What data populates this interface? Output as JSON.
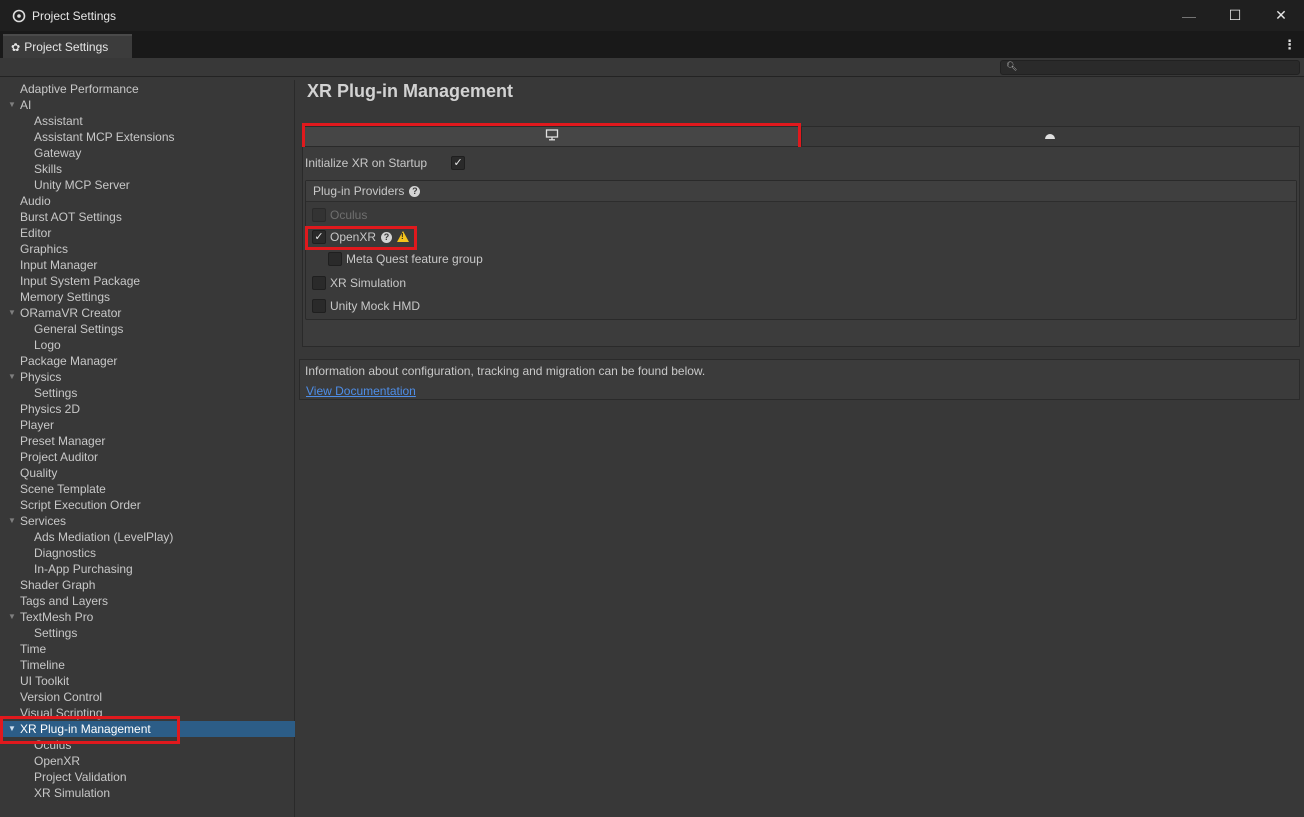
{
  "window": {
    "title": "Project Settings",
    "controls": {
      "minimize": "—",
      "maximize": "☐",
      "close": "✕"
    }
  },
  "tab": {
    "label": "Project Settings",
    "icon": "gear-icon"
  },
  "search": {
    "value": "",
    "placeholder": ""
  },
  "sidebar": {
    "items": [
      {
        "label": "Adaptive Performance"
      },
      {
        "label": "AI"
      },
      {
        "label": "Assistant"
      },
      {
        "label": "Assistant MCP Extensions"
      },
      {
        "label": "Gateway"
      },
      {
        "label": "Skills"
      },
      {
        "label": "Unity MCP Server"
      },
      {
        "label": "Audio"
      },
      {
        "label": "Burst AOT Settings"
      },
      {
        "label": "Editor"
      },
      {
        "label": "Graphics"
      },
      {
        "label": "Input Manager"
      },
      {
        "label": "Input System Package"
      },
      {
        "label": "Memory Settings"
      },
      {
        "label": "ORamaVR Creator"
      },
      {
        "label": "General Settings"
      },
      {
        "label": "Logo"
      },
      {
        "label": "Package Manager"
      },
      {
        "label": "Physics"
      },
      {
        "label": "Settings"
      },
      {
        "label": "Physics 2D"
      },
      {
        "label": "Player"
      },
      {
        "label": "Preset Manager"
      },
      {
        "label": "Project Auditor"
      },
      {
        "label": "Quality"
      },
      {
        "label": "Scene Template"
      },
      {
        "label": "Script Execution Order"
      },
      {
        "label": "Services"
      },
      {
        "label": "Ads Mediation (LevelPlay)"
      },
      {
        "label": "Diagnostics"
      },
      {
        "label": "In-App Purchasing"
      },
      {
        "label": "Shader Graph"
      },
      {
        "label": "Tags and Layers"
      },
      {
        "label": "TextMesh Pro"
      },
      {
        "label": "Settings"
      },
      {
        "label": "Time"
      },
      {
        "label": "Timeline"
      },
      {
        "label": "UI Toolkit"
      },
      {
        "label": "Version Control"
      },
      {
        "label": "Visual Scripting"
      },
      {
        "label": "XR Plug-in Management"
      },
      {
        "label": "Oculus"
      },
      {
        "label": "OpenXR"
      },
      {
        "label": "Project Validation"
      },
      {
        "label": "XR Simulation"
      }
    ]
  },
  "main": {
    "heading": "XR Plug-in Management",
    "platform_tabs": [
      {
        "icon": "monitor-icon",
        "active": true
      },
      {
        "icon": "android-icon",
        "active": false
      }
    ],
    "init_xr_label": "Initialize XR on Startup",
    "init_xr_checked": true,
    "providers_header": "Plug-in Providers",
    "providers": [
      {
        "label": "Oculus",
        "checked": false,
        "disabled": true
      },
      {
        "label": "OpenXR",
        "checked": true,
        "disabled": false
      },
      {
        "label": "Meta Quest feature group",
        "checked": false,
        "disabled": false
      },
      {
        "label": "XR Simulation",
        "checked": false,
        "disabled": false
      },
      {
        "label": "Unity Mock HMD",
        "checked": false,
        "disabled": false
      }
    ],
    "info_text": "Information about configuration, tracking and migration can be found below.",
    "doc_link": "View Documentation"
  },
  "colors": {
    "highlight": "#e0191d",
    "selection": "#2c5d87",
    "link": "#4e8ee8",
    "warning": "#f4c21b"
  }
}
